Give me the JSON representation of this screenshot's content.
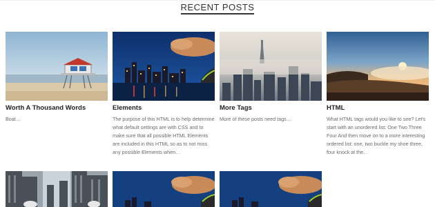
{
  "section": {
    "title": "RECENT POSTS"
  },
  "posts": [
    {
      "title": "Worth A Thousand Words",
      "excerpt": "Boat…",
      "image": "beach-lifeguard-tower"
    },
    {
      "title": "Elements",
      "excerpt": "The purpose of this HTML is to help determine what default settings are with CSS and to make sure that all possible HTML Elements are included in this HTML so as to not miss any possible Elements when…",
      "image": "city-skyline-night"
    },
    {
      "title": "More Tags",
      "excerpt": "More of these posts need tags…",
      "image": "foggy-city-towers"
    },
    {
      "title": "HTML",
      "excerpt": "What HTML tags would you like to see? Let's start with an unordered list: One Two Three Four And then move on to a more interesting ordered list: one, two buckle my shoe three, four knock at the…",
      "image": "sunset-over-mist"
    }
  ],
  "bottom_row_images": [
    "city-street-buildings",
    "city-skyline-night",
    "city-skyline-night"
  ]
}
